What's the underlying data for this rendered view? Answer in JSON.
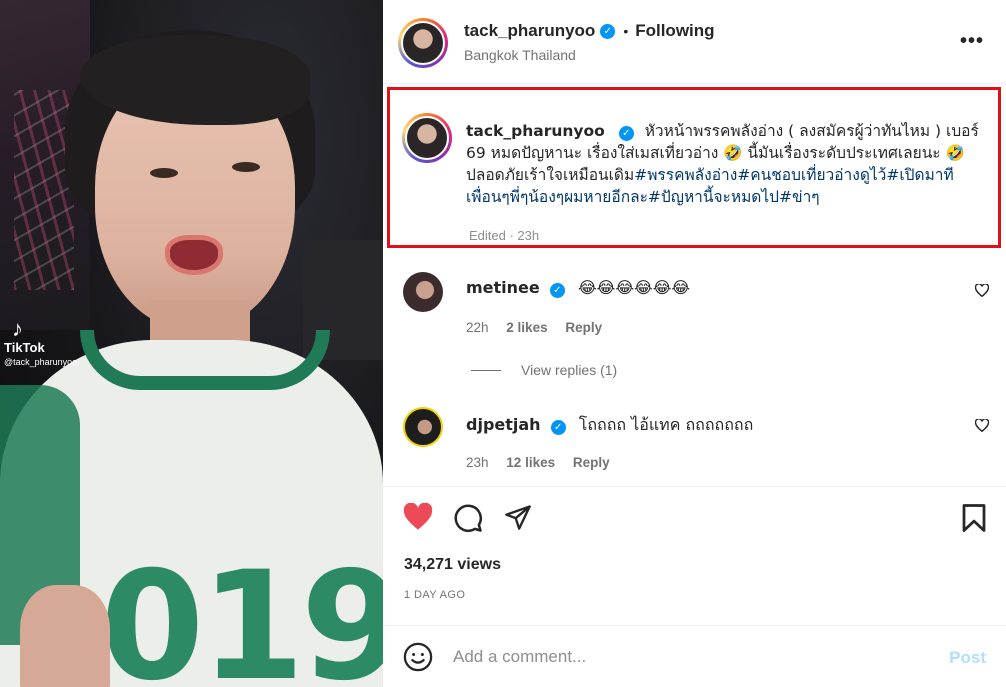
{
  "media": {
    "watermark_logo": "TikTok",
    "watermark_handle": "@tack_pharunyoo",
    "shirt_number": "019"
  },
  "header": {
    "username": "tack_pharunyoo",
    "following_label": "Following",
    "location": "Bangkok Thailand",
    "more_icon": "more-horizontal-icon"
  },
  "caption": {
    "username": "tack_pharunyoo",
    "text": "หัวหน้าพรรคพลังอ่าง ( ลงสมัครผู้ว่าทันไหม ) เบอร์ 69 หมดปัญหานะ เรื่องใส่เมสเที่ยวอ่าง 🤣 นี้มันเรื่องระดับประเทศเลยนะ 🤣 ปลอดภัยเร้าใจเหมือนเดิม",
    "hashtags": [
      "#พรรคพลังอ่าง",
      "#คนชอบเที่ยวอ่างดูไว้",
      "#เปิดมาทีเพื่อนๆพี่ๆน้องๆผมหายอีกละ",
      "#ปัญหานี้จะหมดไป",
      "#ข่าๆ"
    ],
    "meta": "Edited · 23h"
  },
  "comments": [
    {
      "username": "metinee",
      "text": "😂😂😂😂😂😂",
      "time": "22h",
      "likes": "2 likes",
      "reply_label": "Reply"
    },
    {
      "username": "djpetjah",
      "text": "โถถถถ ไอ้แทค ถถถถถถถ",
      "time": "23h",
      "likes": "12 likes",
      "reply_label": "Reply"
    }
  ],
  "view_replies": "View replies (1)",
  "stats": {
    "views": "34,271 views",
    "date": "1 DAY AGO"
  },
  "composer": {
    "placeholder": "Add a comment...",
    "post_label": "Post"
  },
  "colors": {
    "like_red": "#ed4956",
    "verified_blue": "#0095f6",
    "hashtag": "#00376b",
    "highlight_border": "#e0101a"
  }
}
